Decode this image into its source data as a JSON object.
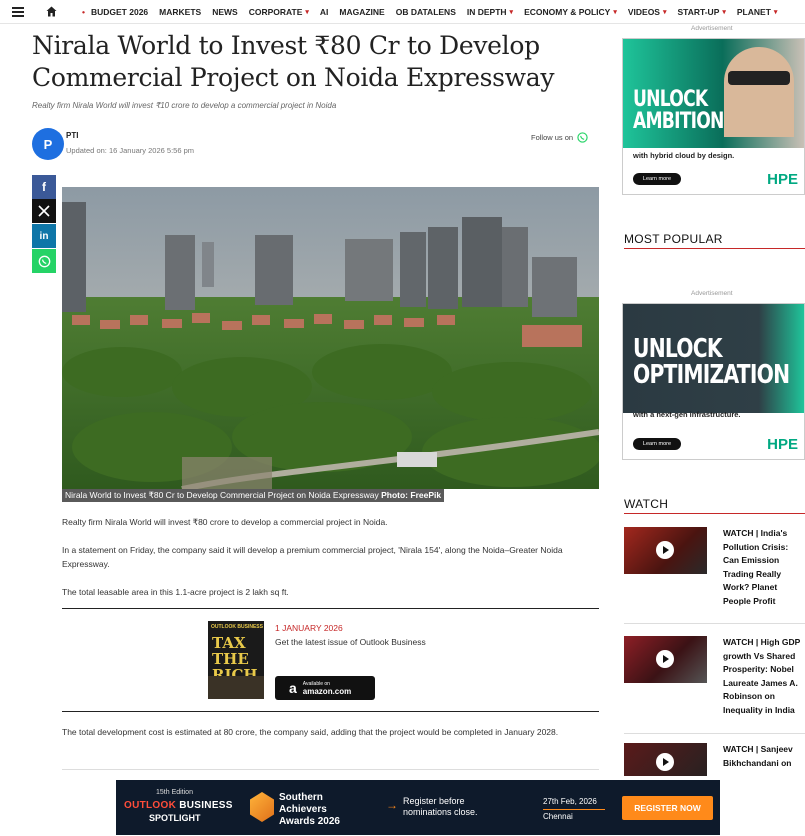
{
  "nav": {
    "items": [
      {
        "label": "BUDGET 2026",
        "chev": false
      },
      {
        "label": "MARKETS",
        "chev": false
      },
      {
        "label": "NEWS",
        "chev": false
      },
      {
        "label": "CORPORATE",
        "chev": true
      },
      {
        "label": "AI",
        "chev": false
      },
      {
        "label": "MAGAZINE",
        "chev": false
      },
      {
        "label": "OB DATALENS",
        "chev": false
      },
      {
        "label": "IN DEPTH",
        "chev": true
      },
      {
        "label": "ECONOMY & POLICY",
        "chev": true
      },
      {
        "label": "VIDEOS",
        "chev": true
      },
      {
        "label": "START-UP",
        "chev": true
      },
      {
        "label": "PLANET",
        "chev": true
      }
    ]
  },
  "article": {
    "title": "Nirala World to Invest ₹80 Cr to Develop Commercial Project on Noida Expressway",
    "subtitle": "Realty firm Nirala World will invest ₹10 crore to develop a commercial project in Noida",
    "author_initial": "P",
    "author": "PTI",
    "updated": "Updated on: 16 January 2026 5:56 pm",
    "follow_label": "Follow us on",
    "caption": "Nirala World to Invest ₹80 Cr to Develop Commercial Project on Noida Expressway",
    "caption_credit": "Photo: FreePik",
    "paragraphs": [
      "Realty firm Nirala World will invest ₹80 crore to develop a commercial project in Noida.",
      "In a statement on Friday, the company said it will develop a premium commercial project, 'Nirala 154', along the Noida–Greater Noida Expressway.",
      "The total leasable area in this 1.1-acre project is 2 lakh sq ft."
    ],
    "paragraph_after": "The total development cost is estimated at 80 crore, the company said, adding that the project would be completed in January 2028."
  },
  "magazine": {
    "date": "1 JANUARY 2026",
    "text": "Get the latest issue of Outlook Business",
    "cover_title": "TAX THE RICH",
    "cover_brand": "OUTLOOK BUSINESS",
    "amazon_small": "Available on",
    "amazon_brand": "amazon.com"
  },
  "ads": {
    "label": "Advertisement",
    "ad1": {
      "line1": "UNLOCK",
      "line2": "AMBITION",
      "tag": "with hybrid cloud by design.",
      "learn": "Learn more",
      "brand": "HPE"
    },
    "ad2": {
      "line1": "UNLOCK",
      "line2": "OPTIMIZATION",
      "tag": "with a next-gen infrastructure.",
      "learn": "Learn more",
      "brand": "HPE"
    }
  },
  "sidebar": {
    "most_popular": "MOST POPULAR",
    "watch": "WATCH",
    "watch_items": [
      {
        "title": "WATCH | India's Pollution Crisis: Can Emission Trading Really Work? Planet People Profit"
      },
      {
        "title": "WATCH | High GDP growth Vs Shared Prosperity: Nobel Laureate James A. Robinson on Inequality in India"
      },
      {
        "title": "WATCH | Sanjeev Bikhchandani on"
      }
    ]
  },
  "banner": {
    "edition": "15th Edition",
    "ob1": "OUTLOOK",
    "ob2": "BUSINESS",
    "spotlight": "SPOTLIGHT",
    "award1": "Southern",
    "award2": "Achievers",
    "award3": "Awards 2026",
    "reg1": "Register before",
    "reg2": "nominations close.",
    "date1": "27th Feb, 2026",
    "date2": "Chennai",
    "cta": "REGISTER NOW"
  }
}
